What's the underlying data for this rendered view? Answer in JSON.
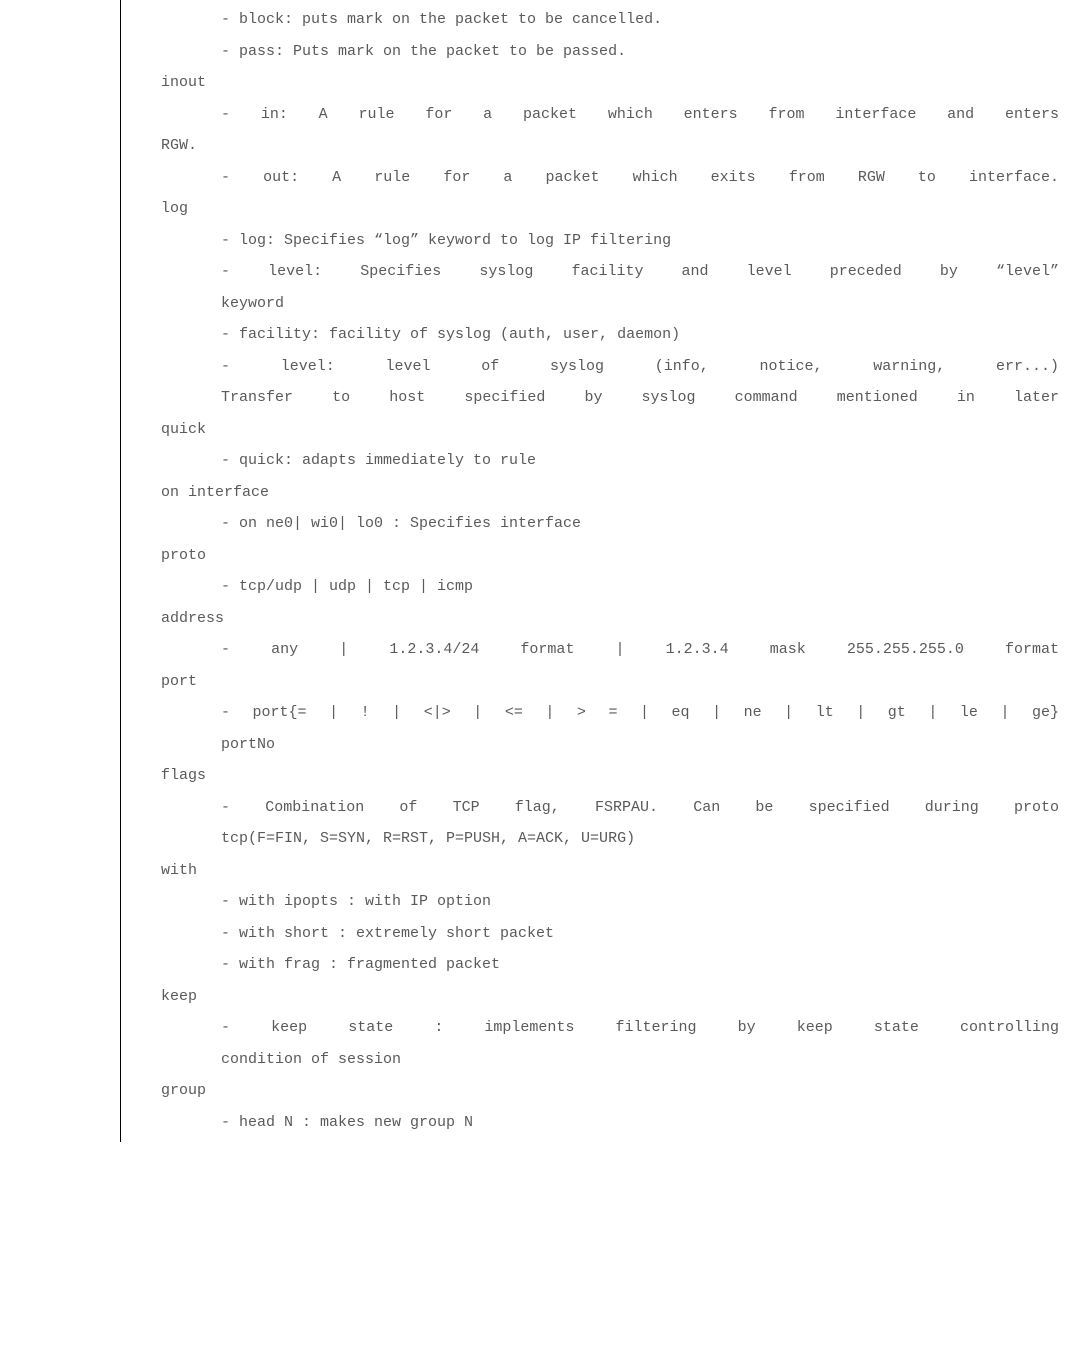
{
  "lines": [
    {
      "cls": "line indent1",
      "text": "- block: puts mark on the packet to be cancelled."
    },
    {
      "cls": "line indent1",
      "text": "- pass: Puts mark on the packet to be passed."
    },
    {
      "cls": "line head",
      "text": "inout"
    },
    {
      "cls": "line indent1 just",
      "text": "- in: A rule for a packet which enters from interface and enters"
    },
    {
      "cls": "line head",
      "text": "RGW."
    },
    {
      "cls": "line indent1 just",
      "text": "- out: A rule for a packet which exits from RGW to interface."
    },
    {
      "cls": "line head",
      "text": "log"
    },
    {
      "cls": "line indent1",
      "text": "- log: Specifies “log” keyword to log IP filtering"
    },
    {
      "cls": "line indent1 just",
      "text": "- level: Specifies syslog facility and level preceded by “level”"
    },
    {
      "cls": "line indent1",
      "text": "keyword"
    },
    {
      "cls": "line indent1",
      "text": "- facility: facility of syslog (auth, user, daemon)"
    },
    {
      "cls": "line indent1 just",
      "text": "- level: level of syslog (info, notice, warning, err...)"
    },
    {
      "cls": "line indent1 just",
      "text": "Transfer to host specified by syslog command mentioned in later"
    },
    {
      "cls": "line head",
      "text": "quick"
    },
    {
      "cls": "line indent1",
      "text": "- quick: adapts immediately to rule"
    },
    {
      "cls": "line head",
      "text": "on interface"
    },
    {
      "cls": "line indent1",
      "text": "- on ne0| wi0| lo0 : Specifies interface"
    },
    {
      "cls": "line head",
      "text": "proto"
    },
    {
      "cls": "line indent1",
      "text": "- tcp/udp | udp | tcp | icmp"
    },
    {
      "cls": "line head",
      "text": "address"
    },
    {
      "cls": "line indent1 just",
      "text": "- any | 1.2.3.4/24 format | 1.2.3.4 mask 255.255.255.0 format"
    },
    {
      "cls": "line head",
      "text": "port"
    },
    {
      "cls": "line indent1 just",
      "text": "- port{= | ! | <|> | <= | > = | eq | ne | lt | gt | le | ge}"
    },
    {
      "cls": "line indent1",
      "text": "portNo"
    },
    {
      "cls": "line head",
      "text": "flags"
    },
    {
      "cls": "line indent1 just",
      "text": "- Combination of TCP flag, FSRPAU. Can be specified during proto"
    },
    {
      "cls": "line indent1",
      "text": "tcp(F=FIN, S=SYN, R=RST, P=PUSH, A=ACK, U=URG)"
    },
    {
      "cls": "line head",
      "text": "with"
    },
    {
      "cls": "line indent1",
      "text": "- with ipopts : with IP option"
    },
    {
      "cls": "line indent1",
      "text": "- with short : extremely short packet"
    },
    {
      "cls": "line indent1",
      "text": "- with frag : fragmented packet"
    },
    {
      "cls": "line head",
      "text": "keep"
    },
    {
      "cls": "line indent1 just",
      "text": "- keep state : implements filtering by keep state controlling"
    },
    {
      "cls": "line indent1",
      "text": "condition of session"
    },
    {
      "cls": "line head",
      "text": "group"
    },
    {
      "cls": "line indent1",
      "text": "- head N : makes new group N"
    }
  ]
}
